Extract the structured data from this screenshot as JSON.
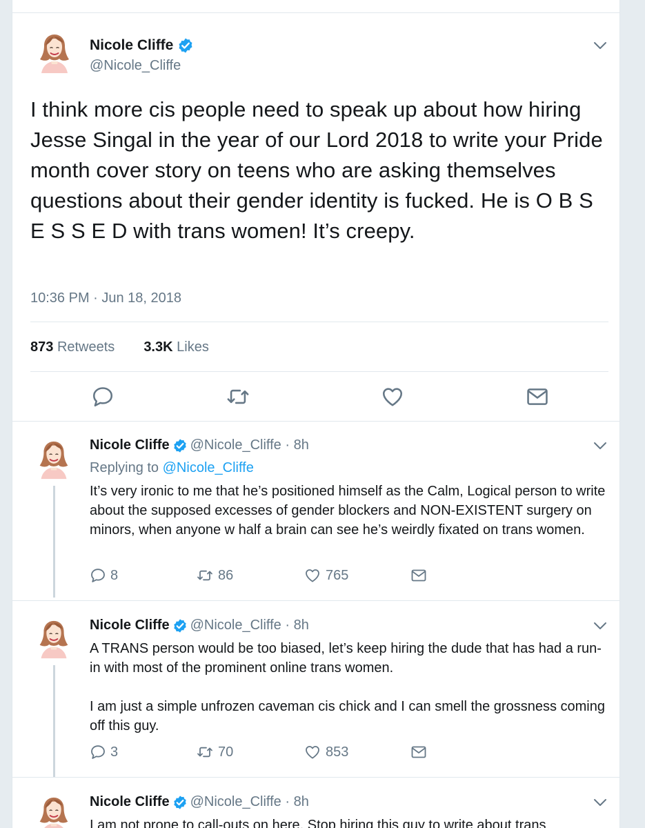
{
  "main_tweet": {
    "name": "Nicole Cliffe",
    "handle": "@Nicole_Cliffe",
    "text": "I think more cis people need to speak up about how hiring Jesse Singal in the year of our Lord 2018 to write your Pride month cover story on teens who are asking themselves questions about their gender identity is fucked. He is O B S E S S E D with trans women! It’s creepy.",
    "timestamp": "10:36 PM · Jun 18, 2018",
    "retweets_count": "873",
    "retweets_label": "Retweets",
    "likes_count": "3.3K",
    "likes_label": "Likes"
  },
  "replies": [
    {
      "name": "Nicole Cliffe",
      "handle": "@Nicole_Cliffe",
      "time": "· 8h",
      "replying_prefix": "Replying to ",
      "replying_to": "@Nicole_Cliffe",
      "paragraphs": [
        "It’s very ironic to me that he’s positioned himself as the Calm, Logical person to write about the supposed excesses of gender blockers and NON-EXISTENT surgery on minors, when anyone w half a brain can see he’s weirdly fixated on trans women."
      ],
      "reply_count": "8",
      "retweet_count": "86",
      "like_count": "765"
    },
    {
      "name": "Nicole Cliffe",
      "handle": "@Nicole_Cliffe",
      "time": "· 8h",
      "paragraphs": [
        "A TRANS person would be too biased, let’s keep hiring the dude that has had a run-in with most of the prominent online trans women.",
        "I am just a simple unfrozen caveman cis chick and I can smell the grossness coming off this guy."
      ],
      "reply_count": "3",
      "retweet_count": "70",
      "like_count": "853"
    },
    {
      "name": "Nicole Cliffe",
      "handle": "@Nicole_Cliffe",
      "time": "· 8h",
      "paragraphs": [
        "I am not prone to call-outs on here. Stop hiring this guy to write about trans"
      ]
    }
  ],
  "colors": {
    "accent": "#1da1f2",
    "text": "#14171a",
    "secondary": "#657786",
    "border": "#e1e8ed",
    "thread_line": "#ccd6dd"
  },
  "icons": [
    "verified-badge-icon",
    "chevron-down-icon",
    "reply-icon",
    "retweet-icon",
    "like-icon",
    "direct-message-icon"
  ]
}
